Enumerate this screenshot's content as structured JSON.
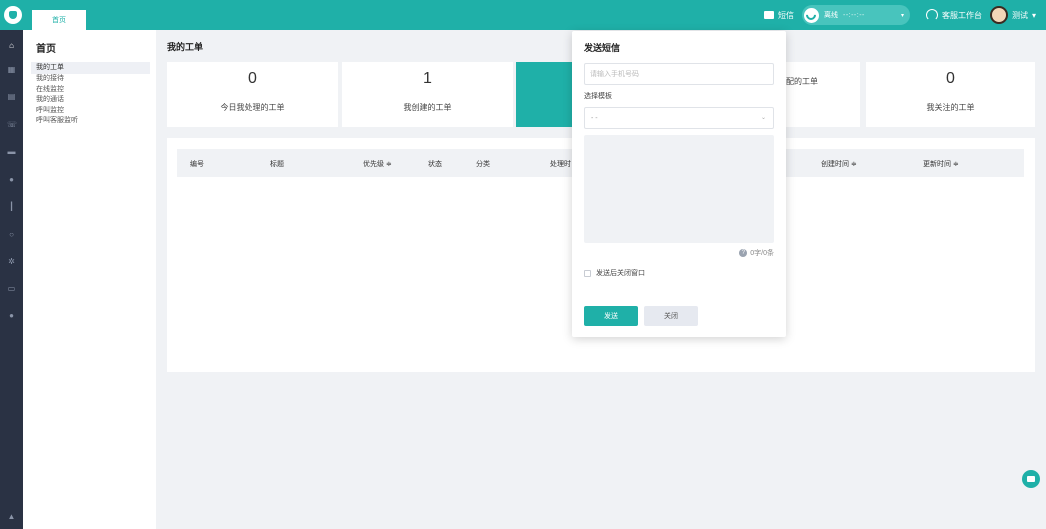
{
  "topbar": {
    "home_tab": "首页",
    "sms_label": "短信",
    "status_label": "离线",
    "timer": "--:--:--",
    "workbench_label": "客服工作台",
    "user_name": "测试",
    "accent": "#1fb0a8"
  },
  "sidebar_icons": [
    "home-icon",
    "grid-icon",
    "doc-icon",
    "phone-icon",
    "chat-icon",
    "user-icon",
    "chart-icon",
    "search-icon",
    "settings-icon",
    "wallet-icon",
    "info-icon"
  ],
  "submenu": {
    "title": "首页",
    "items": [
      "我的工单",
      "我的接待",
      "在线监控",
      "我的通话",
      "呼叫监控",
      "呼叫客服监听"
    ]
  },
  "main": {
    "page_title": "我的工单",
    "cards": [
      {
        "num": "0",
        "label": "今日我处理的工单"
      },
      {
        "num": "1",
        "label": "我创建的工单"
      },
      {
        "num": "",
        "label": ""
      },
      {
        "num": "",
        "label": "配的工单"
      },
      {
        "num": "0",
        "label": "我关注的工单"
      }
    ],
    "columns": [
      "编号",
      "标题",
      "优先级 ≑",
      "状态",
      "分类",
      "处理时",
      "创建时间 ≑",
      "更新时间 ≑"
    ]
  },
  "modal": {
    "title": "发送短信",
    "phone_placeholder": "请输入手机号码",
    "template_label": "选择模板",
    "template_value": "- -",
    "counter": "0字/0条",
    "close_after_label": "发送后关闭窗口",
    "send_label": "发送",
    "close_label": "关闭"
  }
}
